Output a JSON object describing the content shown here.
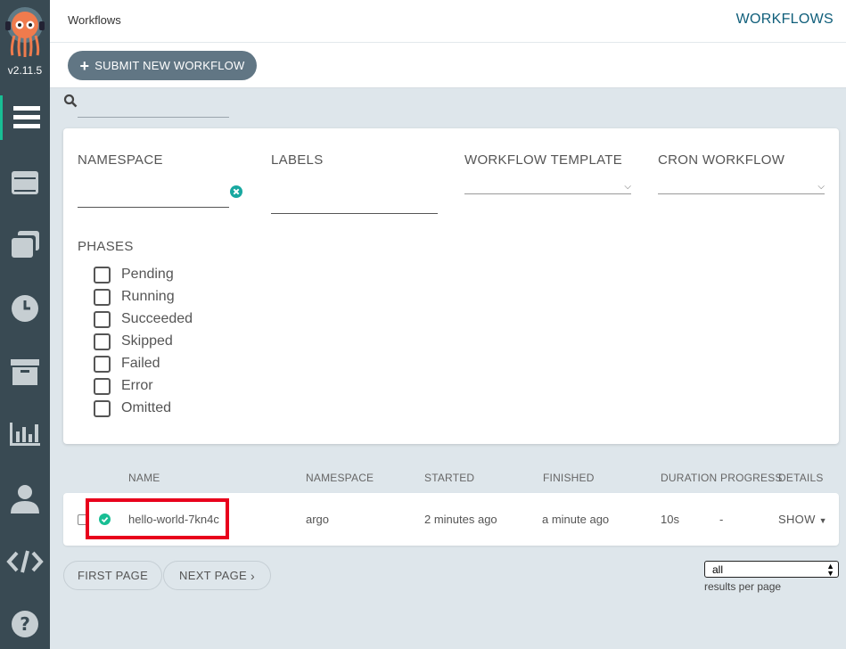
{
  "app": {
    "version": "v2.11.5"
  },
  "topbar": {
    "breadcrumb": "Workflows",
    "title": "WORKFLOWS"
  },
  "toolbar": {
    "submit_label": "SUBMIT NEW WORKFLOW"
  },
  "search": {
    "value": "",
    "placeholder": ""
  },
  "nav": [
    {
      "icon": "workflows-icon",
      "active": true
    },
    {
      "icon": "workflow-templates-icon",
      "active": false
    },
    {
      "icon": "cluster-templates-icon",
      "active": false
    },
    {
      "icon": "cron-workflows-icon",
      "active": false
    },
    {
      "icon": "archive-icon",
      "active": false
    },
    {
      "icon": "reports-icon",
      "active": false
    },
    {
      "icon": "user-icon",
      "active": false
    },
    {
      "icon": "api-docs-icon",
      "active": false
    },
    {
      "icon": "help-icon",
      "active": false
    }
  ],
  "filters": {
    "namespace_label": "NAMESPACE",
    "labels_label": "LABELS",
    "workflow_template_label": "WORKFLOW TEMPLATE",
    "cron_workflow_label": "CRON WORKFLOW",
    "phases_label": "PHASES",
    "phases": [
      {
        "label": "Pending",
        "checked": false
      },
      {
        "label": "Running",
        "checked": false
      },
      {
        "label": "Succeeded",
        "checked": false
      },
      {
        "label": "Skipped",
        "checked": false
      },
      {
        "label": "Failed",
        "checked": false
      },
      {
        "label": "Error",
        "checked": false
      },
      {
        "label": "Omitted",
        "checked": false
      }
    ]
  },
  "table": {
    "headers": [
      "NAME",
      "NAMESPACE",
      "STARTED",
      "FINISHED",
      "DURATION",
      "PROGRESS",
      "DETAILS"
    ],
    "rows": [
      {
        "status": "succeeded",
        "name": "hello-world-7kn4c",
        "namespace": "argo",
        "started": "2 minutes ago",
        "finished": "a minute ago",
        "duration": "10s",
        "progress": "-",
        "details": "SHOW"
      }
    ]
  },
  "pagination": {
    "first_page": "FIRST PAGE",
    "next_page": "NEXT PAGE",
    "per_page_value": "all",
    "per_page_label": "results per page"
  },
  "colors": {
    "sidebar": "#394a53",
    "accent": "#0f5e7a",
    "success": "#18be94",
    "highlight": "#e8001c"
  }
}
